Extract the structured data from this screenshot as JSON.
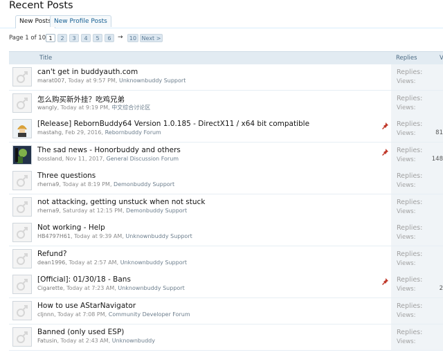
{
  "page_title": "Recent Posts",
  "tabs": [
    {
      "label": "New Posts",
      "active": true
    },
    {
      "label": "New Profile Posts",
      "active": false
    }
  ],
  "pager": {
    "label": "Page 1 of 10",
    "pages": [
      "1",
      "2",
      "3",
      "4",
      "5",
      "6"
    ],
    "arrow": "→",
    "last": "10",
    "next": "Next >"
  },
  "table_header": {
    "title": "Title",
    "replies": "Replies",
    "views": "V"
  },
  "rows": [
    {
      "title": "can't get in buddyauth.com",
      "user": "marat007",
      "sep1": ", ",
      "time": "Today at 9:57 PM",
      "sep2": ", ",
      "forum": "Unknownbuddy Support",
      "replies_label": "Replies:",
      "views_label": "Views:",
      "views": "",
      "sticky": false,
      "avatar": "default-avatar"
    },
    {
      "title": "怎么购买新外挂？吃鸡兄弟",
      "user": "wangly",
      "sep1": ", ",
      "time": "Today at 9:19 PM",
      "sep2": ", ",
      "forum": "中文综合讨论区",
      "replies_label": "Replies:",
      "views_label": "Views:",
      "views": "",
      "sticky": false,
      "avatar": "default-avatar"
    },
    {
      "title": "[Release] RebornBuddy64 Version 1.0.185 - DirectX11 / x64 bit compatible",
      "user": "mastahg",
      "sep1": ", ",
      "time": "Feb 29, 2016",
      "sep2": ", ",
      "forum": "Rebornbuddy Forum",
      "replies_label": "Replies:",
      "views_label": "Views:",
      "views": "81",
      "sticky": true,
      "avatar": "character-avatar"
    },
    {
      "title": "The sad news - Honorbuddy and others",
      "user": "bossland",
      "sep1": ", ",
      "time": "Nov 11, 2017",
      "sep2": ", ",
      "forum": "General Discussion Forum",
      "replies_label": "Replies:",
      "views_label": "Views:",
      "views": "148",
      "sticky": true,
      "avatar": "logo-avatar"
    },
    {
      "title": "Three questions",
      "user": "rherna9",
      "sep1": ", ",
      "time": "Today at 8:19 PM",
      "sep2": ", ",
      "forum": "Demonbuddy Support",
      "replies_label": "Replies:",
      "views_label": "Views:",
      "views": "",
      "sticky": false,
      "avatar": "default-avatar"
    },
    {
      "title": "not attacking, getting unstuck when not stuck",
      "user": "rherna9",
      "sep1": ", ",
      "time": "Saturday at 12:15 PM",
      "sep2": ", ",
      "forum": "Demonbuddy Support",
      "replies_label": "Replies:",
      "views_label": "Views:",
      "views": "",
      "sticky": false,
      "avatar": "default-avatar"
    },
    {
      "title": "Not working - Help",
      "user": "HB4797H61",
      "sep1": ", ",
      "time": "Today at 9:39 AM",
      "sep2": ", ",
      "forum": "Unknownbuddy Support",
      "replies_label": "Replies:",
      "views_label": "Views:",
      "views": "",
      "sticky": false,
      "avatar": "default-avatar"
    },
    {
      "title": "Refund?",
      "user": "dean1996",
      "sep1": ", ",
      "time": "Today at 2:57 AM",
      "sep2": ", ",
      "forum": "Unknownbuddy Support",
      "replies_label": "Replies:",
      "views_label": "Views:",
      "views": "",
      "sticky": false,
      "avatar": "default-avatar"
    },
    {
      "title": "[Official]: 01/30/18 - Bans",
      "user": "Cigarette",
      "sep1": ", ",
      "time": "Today at 7:23 AM",
      "sep2": ", ",
      "forum": "Unknownbuddy Support",
      "replies_label": "Replies:",
      "views_label": "Views:",
      "views": "2",
      "sticky": true,
      "avatar": "default-avatar"
    },
    {
      "title": "How to use AStarNavigator",
      "user": "cljnnn",
      "sep1": ", ",
      "time": "Today at 7:08 PM",
      "sep2": ", ",
      "forum": "Community Developer Forum",
      "replies_label": "Replies:",
      "views_label": "Views:",
      "views": "",
      "sticky": false,
      "avatar": "default-avatar"
    },
    {
      "title": "Banned (only used ESP)",
      "user": "Fatusin",
      "sep1": ", ",
      "time": "Today at 2:43 AM",
      "sep2": ", ",
      "forum": "Unknownbuddy",
      "replies_label": "Replies:",
      "views_label": "Views:",
      "views": "",
      "sticky": false,
      "avatar": "default-avatar"
    }
  ]
}
